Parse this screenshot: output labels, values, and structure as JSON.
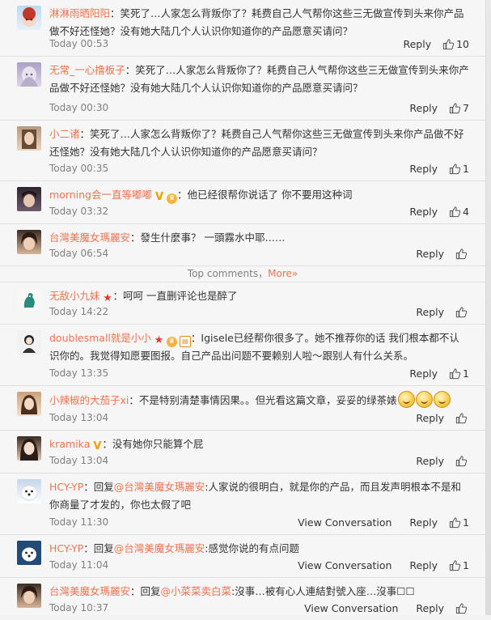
{
  "comments_top": [
    {
      "user": "淋淋雨晒阳阳",
      "text": "：笑死了…人家怎么背叛你了？耗费自己人气帮你这些三无做宣传到头来你产品做不好还怪她？没有她大陆几个人认识你知道你的产品愿意买请问？",
      "time": "Today 00:53",
      "reply": "Reply",
      "likes": "10"
    },
    {
      "user": "无常_一心撸板子",
      "text": "：笑死了…人家怎么背叛你了？耗费自己人气帮你这些三无做宣传到头来你产品做不好还怪她？没有她大陆几个人认识你知道你的产品愿意买请问？",
      "time": "Today 00:30",
      "reply": "Reply",
      "likes": "7"
    },
    {
      "user": "小二诸",
      "text": "：笑死了…人家怎么背叛你了？耗费自己人气帮你这些三无做宣传到头来你产品做不好还怪她？没有她大陆几个人认识你知道你的产品愿意买请问？",
      "time": "Today 00:35",
      "reply": "Reply",
      "likes": "1"
    },
    {
      "user": "morning会一直等嘟嘟",
      "text": "：他已经很帮你说话了 你不要用这种词",
      "time": "Today 03:32",
      "reply": "Reply",
      "likes": "4"
    },
    {
      "user": "台灣美魔女瑪麗安",
      "text": "：發生什麼事？ 一頭霧水中耶……",
      "time": "Today 06:54",
      "reply": "Reply",
      "likes": ""
    }
  ],
  "divider": {
    "label": "Top comments，",
    "more": "More»"
  },
  "comments_bottom": [
    {
      "user": "无敌小九妹",
      "text": "：呵呵 一直删评论也是醉了",
      "time": "Today 14:22",
      "reply": "Reply",
      "likes": ""
    },
    {
      "user": "doublesmall就是小小",
      "text": "：Igisele已经帮你很多了。她不推荐你的话 我们根本都不认识你的。我觉得知愿要图报。自己产品出问题不要赖别人啦～跟别人有什么关系。",
      "time": "Today 13:35",
      "reply": "Reply",
      "likes": "1"
    },
    {
      "user": "小辣椒的大茄子xi",
      "text": "：不是特别清楚事情因果。。但光看这篇文章，妥妥的绿茶婊",
      "time": "Today 13:04",
      "reply": "Reply",
      "likes": ""
    },
    {
      "user": "kramika",
      "text": "：没有她你只能算个屁",
      "time": "Today 13:04",
      "reply": "Reply",
      "likes": ""
    },
    {
      "user": "HCY-YP",
      "pre": "：回复",
      "mention": "@台灣美魔女瑪麗安",
      "text": ":人家说的很明白，就是你的产品，而且发声明根本不是和你商量了才发的，你也太假了吧",
      "time": "Today 11:30",
      "view": "View Conversation",
      "reply": "Reply",
      "likes": "1"
    },
    {
      "user": "HCY-YP",
      "pre": "：回复",
      "mention": "@台灣美魔女瑪麗安",
      "text": ":感觉你说的有点问题",
      "time": "Today 11:04",
      "view": "View Conversation",
      "reply": "Reply",
      "likes": "1"
    },
    {
      "user": "台灣美魔女瑪麗安",
      "pre": "：回复",
      "mention": "@小菜菜卖白菜",
      "text": ":沒事…被有心人連結對號入座…沒事☐☐",
      "time": "Today 10:37",
      "view": "View Conversation",
      "reply": "Reply",
      "likes": ""
    }
  ],
  "icons": {
    "like": "thumbs-up-icon",
    "vip": "v-badge-icon",
    "star": "star-badge-icon"
  },
  "colors": {
    "username": "#eb7350",
    "meta": "#808080",
    "text": "#333333"
  }
}
